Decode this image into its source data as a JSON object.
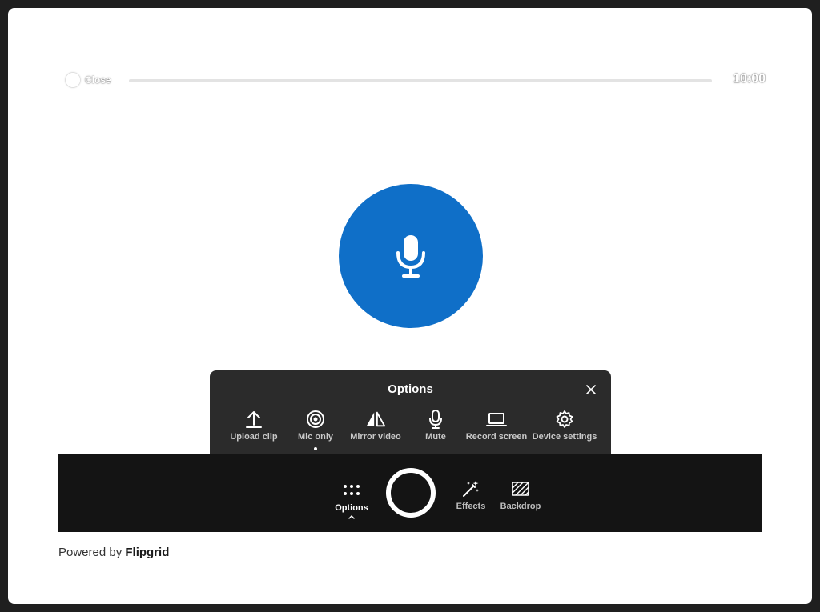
{
  "top_bar": {
    "close_label": "Close",
    "timer": "10:00"
  },
  "options_panel": {
    "title": "Options",
    "items": [
      {
        "label": "Upload clip",
        "icon": "upload-icon"
      },
      {
        "label": "Mic only",
        "icon": "mic-only-icon",
        "selected": true
      },
      {
        "label": "Mirror video",
        "icon": "mirror-icon"
      },
      {
        "label": "Mute",
        "icon": "microphone-icon"
      },
      {
        "label": "Record screen",
        "icon": "laptop-icon"
      },
      {
        "label": "Device settings",
        "icon": "gear-icon"
      }
    ]
  },
  "recorder_bar": {
    "options_label": "Options",
    "effects_label": "Effects",
    "backdrop_label": "Backdrop"
  },
  "footer": {
    "prefix": "Powered by",
    "brand": "Flipgrid"
  },
  "colors": {
    "accent_blue": "#0f6fc8",
    "panel_bg": "#2b2b2b",
    "bar_bg": "#141414"
  }
}
